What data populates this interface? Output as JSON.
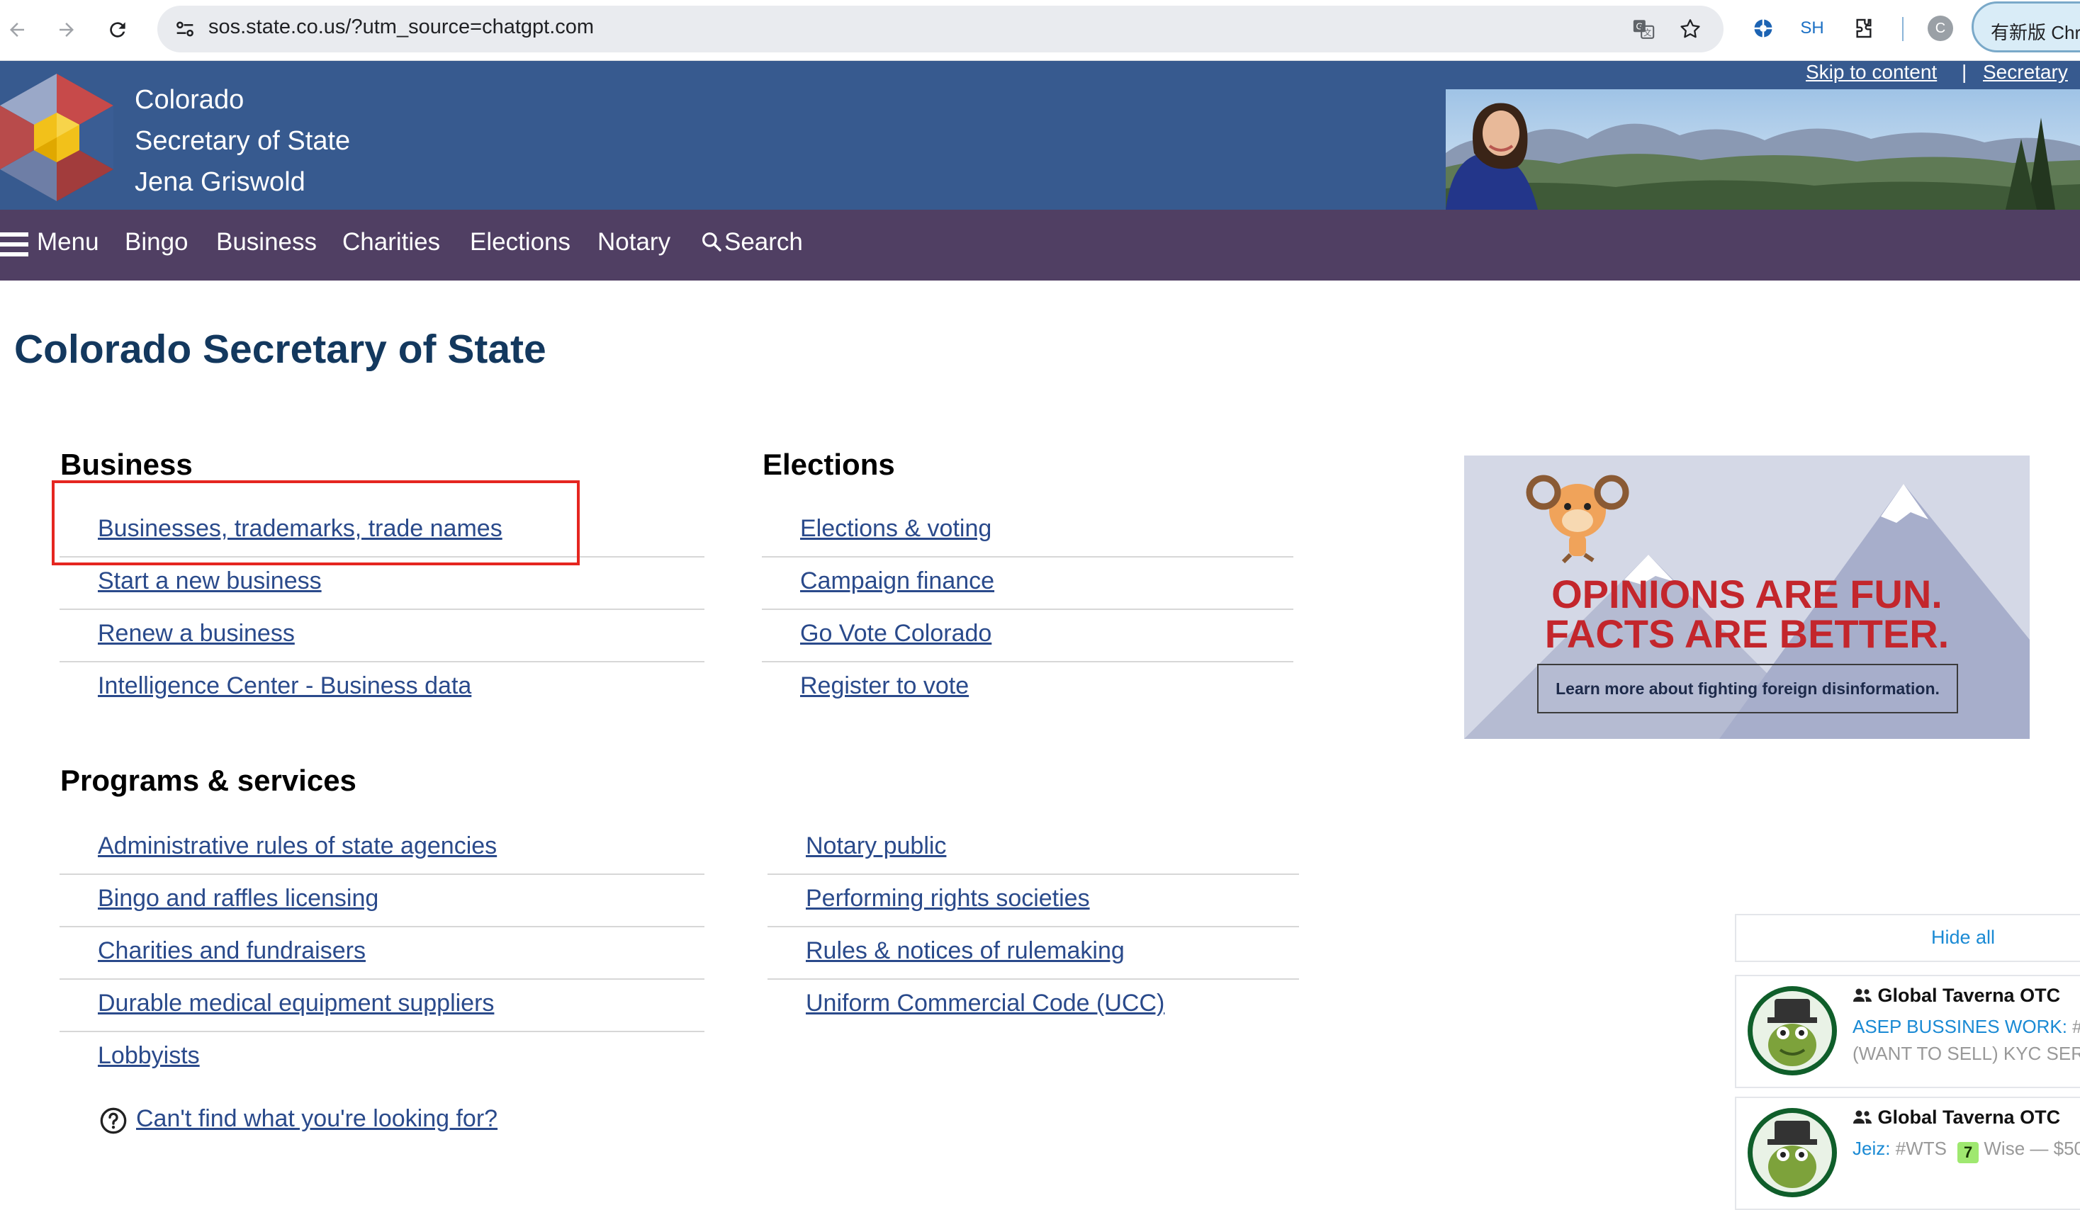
{
  "browser": {
    "url": "sos.state.co.us/?utm_source=chatgpt.com",
    "profile_initial": "C",
    "ext_label": "SH",
    "new_chrome_label": "有新版 Chrome"
  },
  "header": {
    "line1": "Colorado",
    "line2": "Secretary of State",
    "line3": "Jena Griswold",
    "skip_link": "Skip to content",
    "separator": "|",
    "secretary_link": "Secretary"
  },
  "menu": {
    "menu_label": "Menu",
    "items": [
      "Bingo",
      "Business",
      "Charities",
      "Elections",
      "Notary"
    ],
    "search_label": "Search"
  },
  "page_title": "Colorado Secretary of State",
  "business": {
    "heading": "Business",
    "links": [
      "Businesses, trademarks, trade names",
      "Start a new business",
      "Renew a business",
      "Intelligence Center - Business data"
    ]
  },
  "elections": {
    "heading": "Elections",
    "links": [
      "Elections & voting",
      "Campaign finance",
      "Go Vote Colorado",
      "Register to vote"
    ]
  },
  "programs": {
    "heading": "Programs & services",
    "left_links": [
      "Administrative rules of state agencies",
      "Bingo and raffles licensing",
      "Charities and fundraisers",
      "Durable medical equipment suppliers",
      "Lobbyists"
    ],
    "right_links": [
      "Notary public",
      "Performing rights societies",
      "Rules & notices of rulemaking",
      "Uniform Commercial Code (UCC)"
    ]
  },
  "ad": {
    "line1": "OPINIONS ARE FUN.",
    "line2": "FACTS ARE BETTER.",
    "cta": "Learn more about fighting foreign disinformation."
  },
  "help_link": "Can't find what you're looking for?",
  "widget": {
    "hide_all": "Hide all",
    "cards": [
      {
        "name": "Global Taverna OTC",
        "highlight": "ASEP BUSSINES WORK:",
        "rest": " #W",
        "line2": "(WANT TO SELL) KYC SERVI"
      },
      {
        "name": "Global Taverna OTC",
        "highlight": "Jeiz:",
        "rest": " #WTS",
        "wise": "Wise — $50"
      }
    ]
  },
  "colors": {
    "header_blue": "#375a8f",
    "menu_purple": "#503f63",
    "title_navy": "#13385e",
    "link_blue": "#2a4a8b",
    "highlight_red": "#e52620"
  }
}
